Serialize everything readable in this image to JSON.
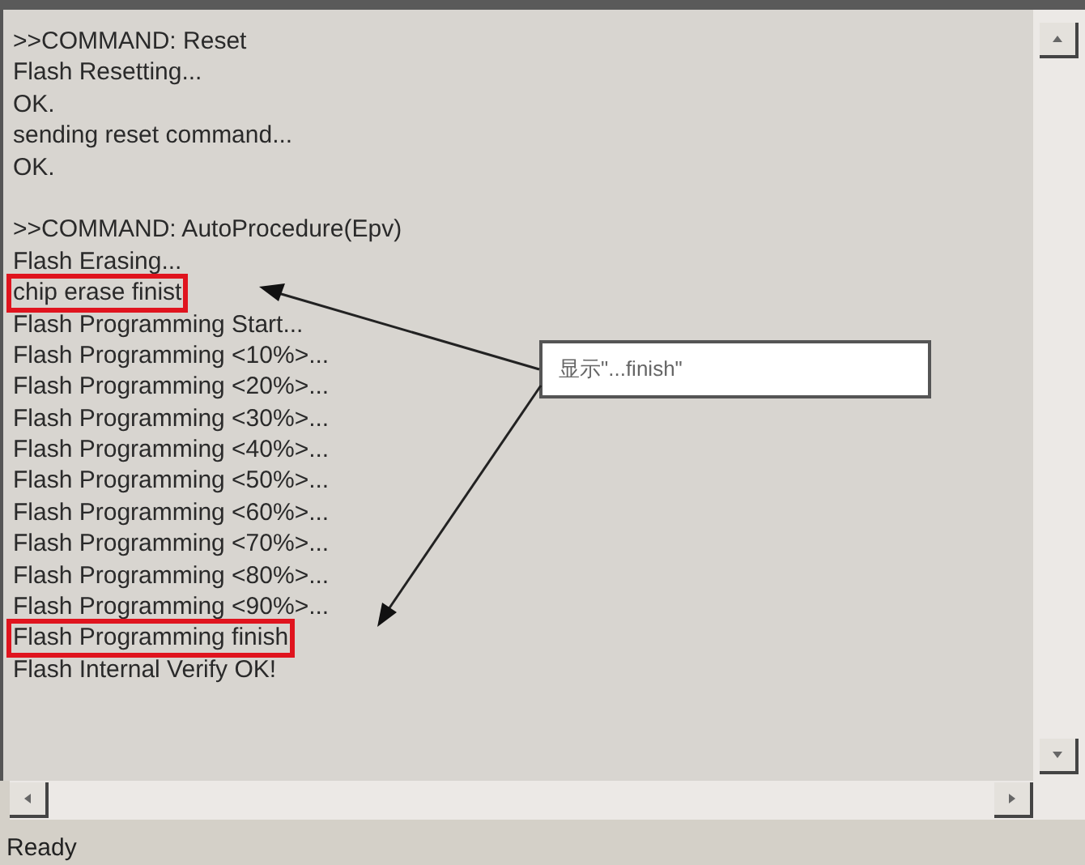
{
  "log_lines": [
    {
      "text": ">>COMMAND: Reset",
      "highlighted": false
    },
    {
      "text": "Flash Resetting...",
      "highlighted": false
    },
    {
      "text": "OK.",
      "highlighted": false
    },
    {
      "text": "sending reset command...",
      "highlighted": false
    },
    {
      "text": "OK.",
      "highlighted": false
    },
    {
      "text": ">>COMMAND: AutoProcedure(Epv)",
      "highlighted": false,
      "gap_before": true
    },
    {
      "text": "Flash Erasing...",
      "highlighted": false
    },
    {
      "text": "chip erase finist",
      "highlighted": true
    },
    {
      "text": "Flash Programming Start...",
      "highlighted": false
    },
    {
      "text": "Flash Programming <10%>...",
      "highlighted": false
    },
    {
      "text": "Flash Programming <20%>...",
      "highlighted": false
    },
    {
      "text": "Flash Programming <30%>...",
      "highlighted": false
    },
    {
      "text": "Flash Programming <40%>...",
      "highlighted": false
    },
    {
      "text": "Flash Programming <50%>...",
      "highlighted": false
    },
    {
      "text": "Flash Programming <60%>...",
      "highlighted": false
    },
    {
      "text": "Flash Programming <70%>...",
      "highlighted": false
    },
    {
      "text": "Flash Programming <80%>...",
      "highlighted": false
    },
    {
      "text": "Flash Programming <90%>...",
      "highlighted": false
    },
    {
      "text": "Flash Programming finish",
      "highlighted": true
    },
    {
      "text": "Flash Internal Verify OK!",
      "highlighted": false
    }
  ],
  "callout": {
    "text": "显示\"...finish\""
  },
  "status_bar": {
    "text": "Ready"
  }
}
